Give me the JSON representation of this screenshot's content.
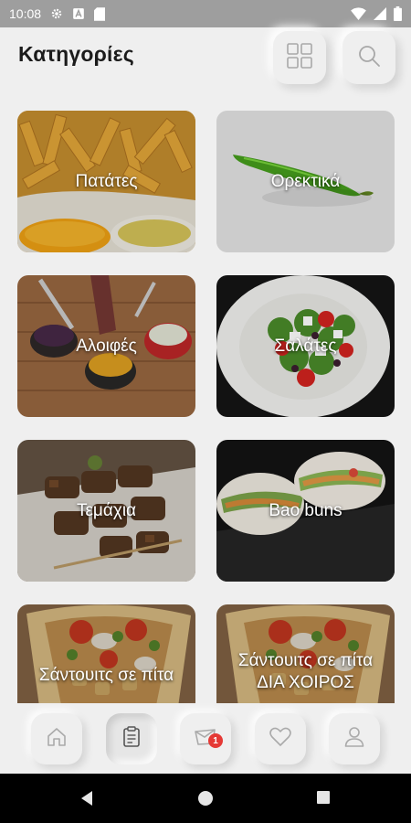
{
  "status_bar": {
    "time": "10:08",
    "left_icons": [
      "gear-icon",
      "a-notification-icon",
      "sd-card-icon"
    ],
    "right_icons": [
      "wifi-icon",
      "signal-icon",
      "battery-icon"
    ]
  },
  "header": {
    "title": "Κατηγορίες",
    "buttons": [
      "grid-view-icon",
      "search-icon"
    ]
  },
  "categories": [
    {
      "label": "Πατάτες",
      "image": "fries-photo"
    },
    {
      "label": "Ορεκτικά",
      "image": "green-pepper-photo"
    },
    {
      "label": "Αλοιφές",
      "image": "dips-photo"
    },
    {
      "label": "Σαλάτες",
      "image": "salad-photo"
    },
    {
      "label": "Τεμάχια",
      "image": "skewers-photo"
    },
    {
      "label": "Bao buns",
      "image": "bao-buns-photo"
    },
    {
      "label": "Σάντουιτς σε πίτα",
      "image": "pita-wrap-photo"
    },
    {
      "label": "Σάντουιτς σε πίτα ΔΙΑ ΧΟΙΡΟΣ",
      "image": "pita-wrap-photo"
    }
  ],
  "bottom_nav": {
    "items": [
      "home-icon",
      "menu-clipboard-icon",
      "cart-icon",
      "heart-icon",
      "user-icon"
    ],
    "active": "menu-clipboard-icon",
    "cart_badge": "1"
  },
  "colors": {
    "background": "#efefef",
    "badge": "#e53935",
    "status_bar": "#9e9e9e"
  }
}
